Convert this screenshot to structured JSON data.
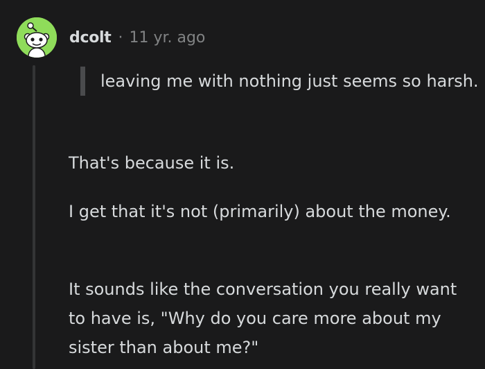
{
  "comment": {
    "avatar_icon": "reddit-snoo-avatar-icon",
    "avatar_color": "#8fdc5a",
    "username": "dcolt",
    "separator": "·",
    "timestamp": "11 yr. ago",
    "quote": "leaving me with nothing just seems so harsh.",
    "paragraphs": [
      "That's because it is.",
      "I get that it's not (primarily) about the money.",
      "It sounds like the conversation you really want to have is, \"Why do you care more about my sister than about me?\""
    ]
  }
}
